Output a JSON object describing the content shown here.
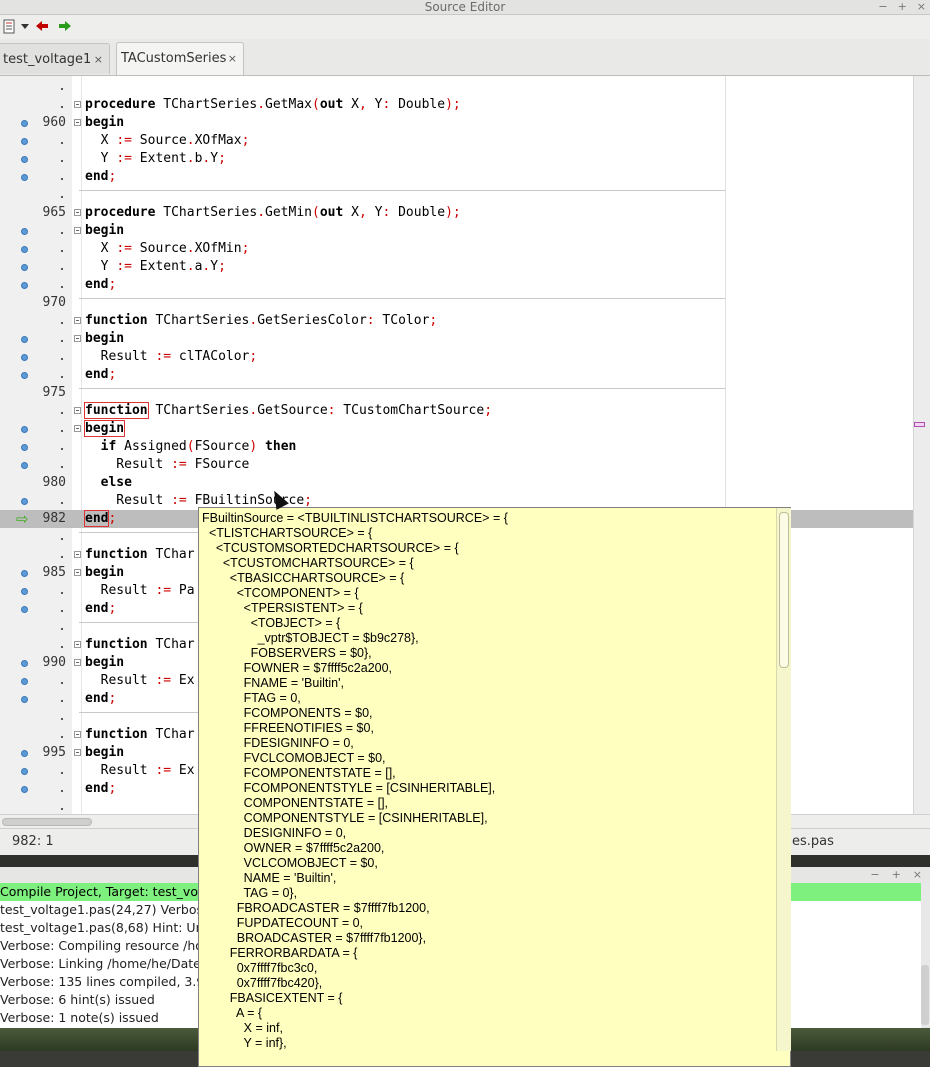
{
  "window": {
    "title": "Source Editor",
    "controls": [
      "−",
      "+",
      "×"
    ]
  },
  "toolbar": {
    "items": [
      "list-icon",
      "dropdown-arrow-icon",
      "back-arrow-icon",
      "forward-arrow-icon"
    ],
    "colors": {
      "back": "#c00000",
      "forward": "#2a9a1a"
    }
  },
  "tabs": [
    {
      "label": "test_voltage1",
      "close": "×"
    },
    {
      "label": "TACustomSeries",
      "close": "×",
      "active": true
    }
  ],
  "editor": {
    "lines": [
      {
        "ln": ".",
        "code": ""
      },
      {
        "ln": ".",
        "code": "procedure TChartSeries.GetMax(out X, Y: Double);"
      },
      {
        "ln": "960",
        "code": "begin"
      },
      {
        "ln": ".",
        "code": "  X := Source.XOfMax;"
      },
      {
        "ln": ".",
        "code": "  Y := Extent.b.Y;"
      },
      {
        "ln": ".",
        "code": "end;"
      },
      {
        "ln": ".",
        "code": ""
      },
      {
        "ln": "965",
        "code": "procedure TChartSeries.GetMin(out X, Y: Double);"
      },
      {
        "ln": ".",
        "code": "begin"
      },
      {
        "ln": ".",
        "code": "  X := Source.XOfMin;"
      },
      {
        "ln": ".",
        "code": "  Y := Extent.a.Y;"
      },
      {
        "ln": ".",
        "code": "end;"
      },
      {
        "ln": "970",
        "code": ""
      },
      {
        "ln": ".",
        "code": "function TChartSeries.GetSeriesColor: TColor;"
      },
      {
        "ln": ".",
        "code": "begin"
      },
      {
        "ln": ".",
        "code": "  Result := clTAColor;"
      },
      {
        "ln": ".",
        "code": "end;"
      },
      {
        "ln": "975",
        "code": ""
      },
      {
        "ln": ".",
        "code": "function TChartSeries.GetSource: TCustomChartSource;"
      },
      {
        "ln": ".",
        "code": "begin"
      },
      {
        "ln": ".",
        "code": "  if Assigned(FSource) then"
      },
      {
        "ln": ".",
        "code": "    Result := FSource"
      },
      {
        "ln": "980",
        "code": "  else"
      },
      {
        "ln": ".",
        "code": "    Result := FBuiltinSource;"
      },
      {
        "ln": "982",
        "code": "end;"
      },
      {
        "ln": ".",
        "code": ""
      },
      {
        "ln": ".",
        "code": "function TChar"
      },
      {
        "ln": "985",
        "code": "begin"
      },
      {
        "ln": ".",
        "code": "  Result := Pa"
      },
      {
        "ln": ".",
        "code": "end;"
      },
      {
        "ln": ".",
        "code": ""
      },
      {
        "ln": ".",
        "code": "function TChar"
      },
      {
        "ln": "990",
        "code": "begin"
      },
      {
        "ln": ".",
        "code": "  Result := Ex"
      },
      {
        "ln": ".",
        "code": "end;"
      },
      {
        "ln": ".",
        "code": ""
      },
      {
        "ln": ".",
        "code": "function TChar"
      },
      {
        "ln": "995",
        "code": "begin"
      },
      {
        "ln": ".",
        "code": "  Result := Ex"
      },
      {
        "ln": ".",
        "code": "end;"
      },
      {
        "ln": ".",
        "code": ""
      }
    ]
  },
  "status": {
    "position": "982:  1",
    "file": "es.pas"
  },
  "messages": [
    "Compile Project, Target: test_volt",
    "test_voltage1.pas(24,27) Verbos",
    "test_voltage1.pas(8,68) Hint: Un",
    "Verbose: Compiling resource /ho",
    "Verbose: Linking /home/he/Date",
    "Verbose: 135 lines compiled, 3.9",
    "Verbose: 6 hint(s) issued",
    "Verbose: 1 note(s) issued"
  ],
  "hint": {
    "lines": [
      "FBuiltinSource = <TBUILTINLISTCHARTSOURCE> = {",
      "  <TLISTCHARTSOURCE> = {",
      "    <TCUSTOMSORTEDCHARTSOURCE> = {",
      "      <TCUSTOMCHARTSOURCE> = {",
      "        <TBASICCHARTSOURCE> = {",
      "          <TCOMPONENT> = {",
      "            <TPERSISTENT> = {",
      "              <TOBJECT> = {",
      "                _vptr$TOBJECT = $b9c278},",
      "              FOBSERVERS = $0},",
      "            FOWNER = $7ffff5c2a200,",
      "            FNAME = 'Builtin',",
      "            FTAG = 0,",
      "            FCOMPONENTS = $0,",
      "            FFREENOTIFIES = $0,",
      "            FDESIGNINFO = 0,",
      "            FVCLCOMOBJECT = $0,",
      "            FCOMPONENTSTATE = [],",
      "            FCOMPONENTSTYLE = [CSINHERITABLE],",
      "            COMPONENTSTATE = [],",
      "            COMPONENTSTYLE = [CSINHERITABLE],",
      "            DESIGNINFO = 0,",
      "            OWNER = $7ffff5c2a200,",
      "            VCLCOMOBJECT = $0,",
      "            NAME = 'Builtin',",
      "            TAG = 0},",
      "          FBROADCASTER = $7ffff7fb1200,",
      "          FUPDATECOUNT = 0,",
      "          BROADCASTER = $7ffff7fb1200},",
      "        FERRORBARDATA = {",
      "          0x7ffff7fbc3c0,",
      "          0x7ffff7fbc420},",
      "        FBASICEXTENT = {",
      "          A = {",
      "            X = inf,",
      "            Y = inf},"
    ]
  }
}
